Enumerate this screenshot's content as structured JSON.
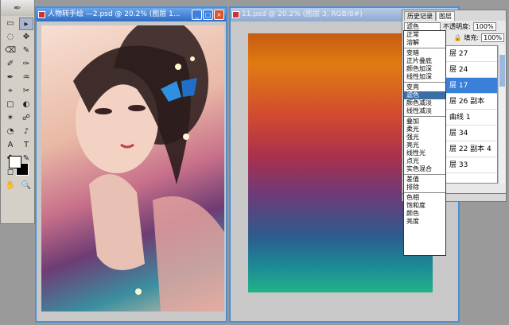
{
  "toolbox": {
    "tools": [
      "▭",
      "▸",
      "◌",
      "✥",
      "⌫",
      "✎",
      "✐",
      "✑",
      "✒",
      "♒",
      "⌖",
      "✂",
      "▢",
      "◐",
      "✶",
      "☍",
      "◔",
      "♪",
      "A",
      "T",
      "✤",
      "✎",
      "◻",
      "✐",
      "✋",
      "🔍"
    ]
  },
  "window1": {
    "title": "人物转手绘 —2.psd @ 20.2% (图层 1..."
  },
  "window2": {
    "title": "11.psd @ 20.2% (图层 3, RGB/8#)"
  },
  "panel": {
    "tabs": [
      "历史记录",
      "图层"
    ],
    "blend_mode": "滤色",
    "opacity_label": "不透明度:",
    "opacity_value": "100%",
    "fill_label": "填充:",
    "fill_value": "100%",
    "layers": [
      "层 27",
      "层 24",
      "层 17",
      "层 26 副本",
      "曲线 1",
      "层 34",
      "层 22 副本 4",
      "层 33"
    ]
  },
  "blend_menu": {
    "groups": [
      [
        "正常",
        "溶解"
      ],
      [
        "变暗",
        "正片叠底",
        "颜色加深",
        "线性加深"
      ],
      [
        "变亮",
        "滤色",
        "颜色减淡",
        "线性减淡"
      ],
      [
        "叠加",
        "柔光",
        "强光",
        "亮光",
        "线性光",
        "点光",
        "实色混合"
      ],
      [
        "差值",
        "排除"
      ],
      [
        "色相",
        "饱和度",
        "颜色",
        "亮度"
      ]
    ],
    "selected": "滤色"
  }
}
